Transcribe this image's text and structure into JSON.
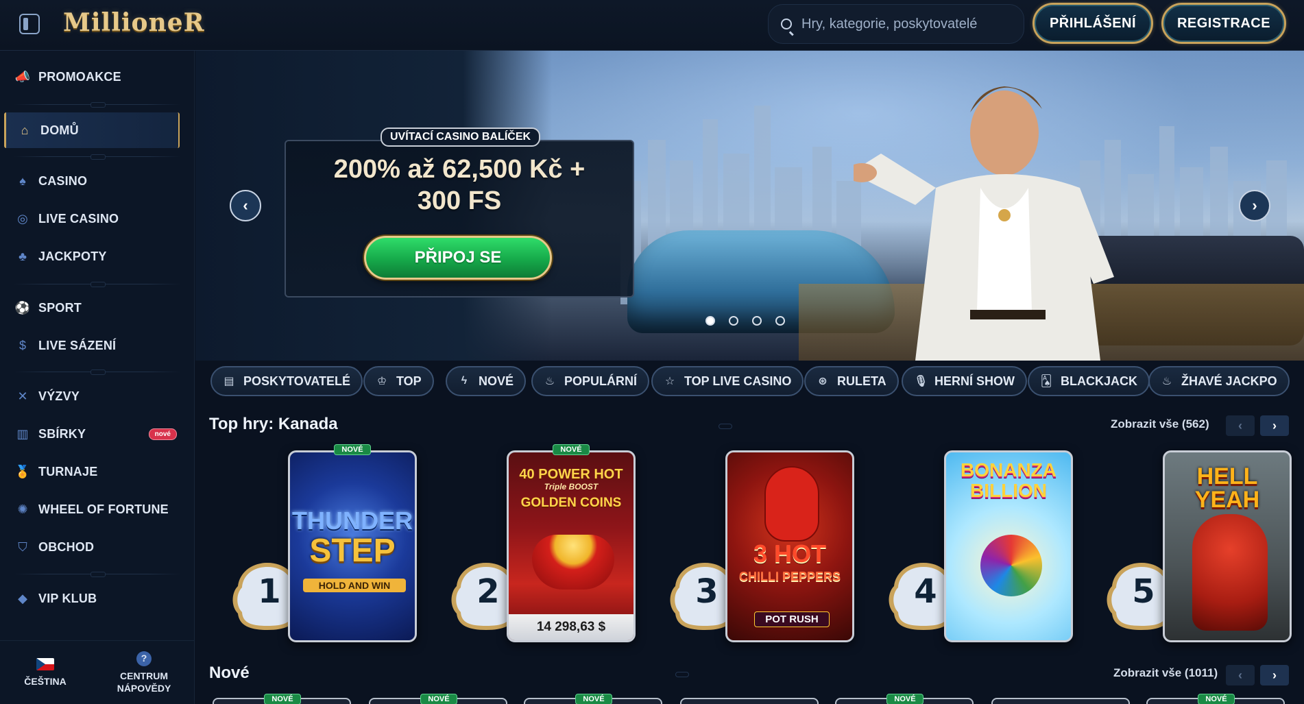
{
  "header": {
    "logo_text": "MillioneR",
    "search_placeholder": "Hry, kategorie, poskytovatelé",
    "login_label": "PŘIHLÁŠENÍ",
    "register_label": "REGISTRACE"
  },
  "sidebar": {
    "items": [
      {
        "label": "PROMOAKCE",
        "icon": "megaphone-icon"
      },
      {
        "label": "DOMŮ",
        "icon": "home-icon",
        "active": true
      },
      {
        "label": "CASINO",
        "icon": "spade-icon"
      },
      {
        "label": "LIVE CASINO",
        "icon": "live-chip-icon"
      },
      {
        "label": "JACKPOTY",
        "icon": "clover-icon"
      },
      {
        "label": "SPORT",
        "icon": "soccer-ball-icon"
      },
      {
        "label": "LIVE SÁZENÍ",
        "icon": "dollar-coin-icon"
      },
      {
        "label": "VÝZVY",
        "icon": "crossed-swords-icon"
      },
      {
        "label": "SBÍRKY",
        "icon": "cards-icon",
        "badge": "nové"
      },
      {
        "label": "TURNAJE",
        "icon": "medal-icon"
      },
      {
        "label": "WHEEL OF FORTUNE",
        "icon": "wheel-icon"
      },
      {
        "label": "OBCHOD",
        "icon": "basket-icon"
      },
      {
        "label": "VIP KLUB",
        "icon": "diamond-icon"
      }
    ],
    "language_label": "ČEŠTINA",
    "help_label_line1": "CENTRUM",
    "help_label_line2": "NÁPOVĚDY"
  },
  "hero": {
    "tag": "UVÍTACÍ CASINO BALÍČEK",
    "title_line1": "200% až 62,500 Kč +",
    "title_line2": "300 FS",
    "cta_label": "PŘIPOJ SE",
    "slide_count": 4,
    "active_slide": 1
  },
  "categories": [
    {
      "label": "POSKYTOVATELÉ",
      "icon": "book-icon"
    },
    {
      "label": "TOP",
      "icon": "crown-icon"
    },
    {
      "label": "NOVÉ",
      "icon": "lightning-icon"
    },
    {
      "label": "POPULÁRNÍ",
      "icon": "flame-icon"
    },
    {
      "label": "TOP LIVE CASINO",
      "icon": "star-icon"
    },
    {
      "label": "RULETA",
      "icon": "roulette-icon"
    },
    {
      "label": "HERNÍ SHOW",
      "icon": "microphone-icon"
    },
    {
      "label": "BLACKJACK",
      "icon": "playing-cards-icon"
    },
    {
      "label": "ŽHAVÉ JACKPO",
      "icon": "hot-pot-icon"
    }
  ],
  "top_games": {
    "title": "Top hry: Kanada",
    "view_all": "Zobrazit vše (562)",
    "games": [
      {
        "rank": "1",
        "title_line1": "THUNDER",
        "title_line2": "STEP",
        "subtitle": "HOLD AND WIN",
        "tag": "NOVÉ"
      },
      {
        "rank": "2",
        "title_line1": "40 POWER HOT",
        "title_line2": "GOLDEN COINS",
        "subtitle": "Triple BOOST",
        "tag": "NOVÉ",
        "jackpot": "14 298,63 $"
      },
      {
        "rank": "3",
        "title_line1": "3 HOT",
        "title_line2": "CHILLI PEPPERS",
        "subtitle": "POT RUSH"
      },
      {
        "rank": "4",
        "title_line1": "BONANZA",
        "title_line2": "BILLION"
      },
      {
        "rank": "5",
        "title_line1": "HELL YEAH"
      }
    ]
  },
  "new_games": {
    "title": "Nové",
    "view_all": "Zobrazit vše (1011)",
    "tag": "NOVÉ"
  },
  "colors": {
    "accent_gold": "#c9a35b",
    "bg": "#0a1220",
    "cta_green": "#16a94a"
  }
}
